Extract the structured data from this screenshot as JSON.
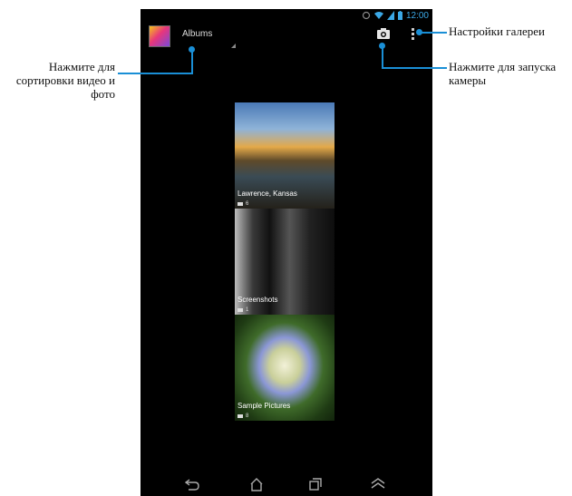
{
  "callouts": {
    "settings": "Настройки галереи",
    "camera_line1": "Нажмите для запуска",
    "camera_line2": "камеры",
    "sort_line1": "Нажмите для",
    "sort_line2": "сортировки видео и",
    "sort_line3": "фото"
  },
  "status_bar": {
    "time": "12:00"
  },
  "app_bar": {
    "title": "Albums"
  },
  "albums": [
    {
      "name": "Lawrence, Kansas",
      "count": "6"
    },
    {
      "name": "Screenshots",
      "count": "1"
    },
    {
      "name": "Sample Pictures",
      "count": "8"
    }
  ],
  "colors": {
    "accent": "#1a8fd6",
    "status_icons": "#3ba8e6"
  },
  "icons": [
    "camera-icon",
    "overflow-menu-icon",
    "back-icon",
    "home-icon",
    "recent-apps-icon",
    "menu-up-icon",
    "folder-icon"
  ]
}
